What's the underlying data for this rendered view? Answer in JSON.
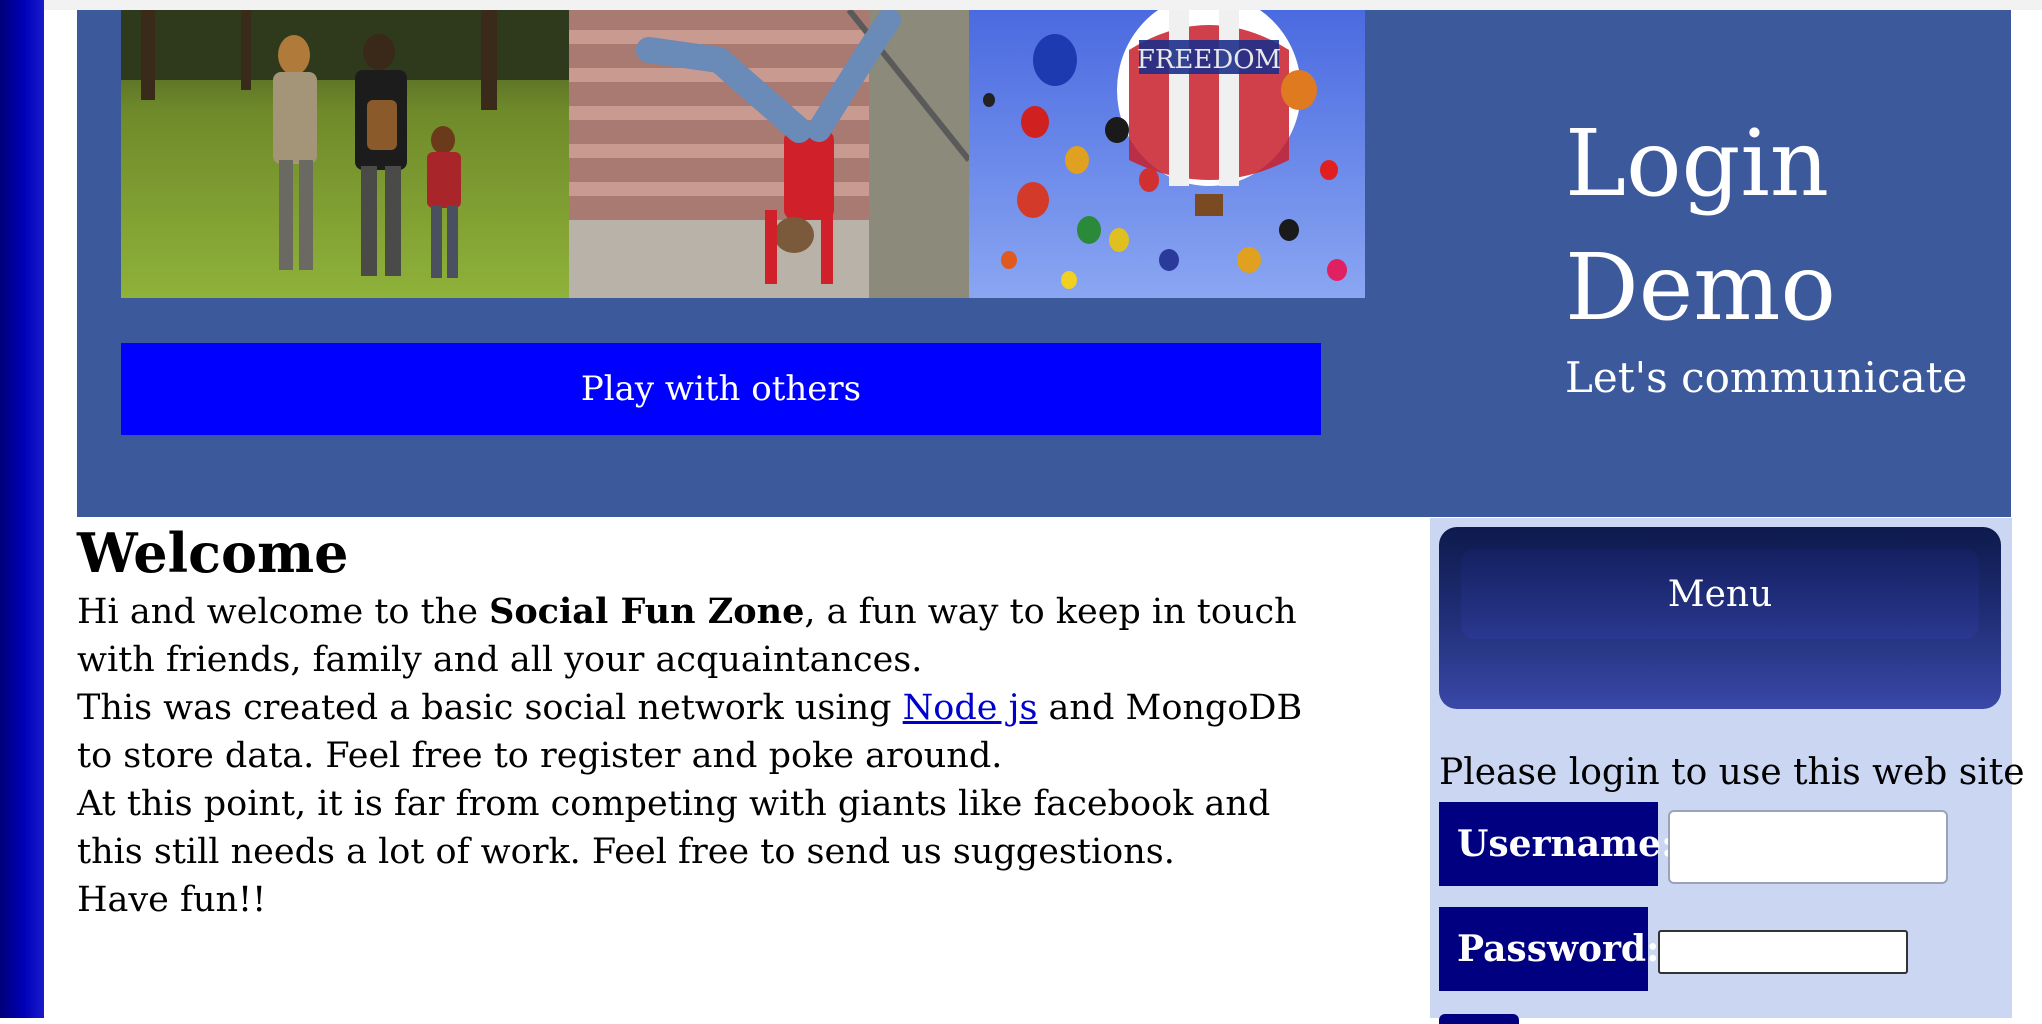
{
  "header": {
    "banner_photos": [
      "family-walking-photo",
      "handstand-photo",
      "hot-air-balloons-photo"
    ],
    "balloon_text": "FREEDOM",
    "play_button": "Play with others",
    "title_line1": "Login",
    "title_line2": "Demo",
    "subtitle": "Let's communicate"
  },
  "main": {
    "title": "Welcome",
    "p1_before": "Hi and welcome to the ",
    "p1_bold": "Social Fun Zone",
    "p1_after": ", a fun way to keep in touch with friends, family and all your acquaintances.",
    "p2_before": "This was created a basic social network using ",
    "p2_link": "Node js",
    "p2_after": " and MongoDB to store data. Feel free to register and poke around.",
    "p3": "At this point, it is far from competing with giants like facebook and this still needs a lot of work. Feel free to send us suggestions.",
    "p4": "Have fun!!"
  },
  "sidebar": {
    "menu_label": "Menu",
    "login_message": "Please login to use this web site",
    "username_label": "Username:",
    "password_label": "Password:",
    "username_value": "",
    "password_value": ""
  },
  "colors": {
    "header_bg": "#3c5a9b",
    "play_bar": "#0000ff",
    "label_bg": "#000080",
    "sidebar_bg": "#cad6f2"
  }
}
